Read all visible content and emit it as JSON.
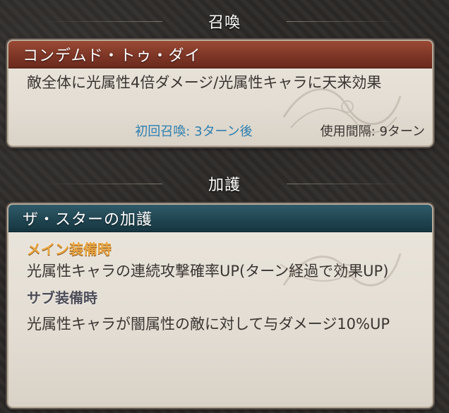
{
  "summon_section": {
    "header": "召喚"
  },
  "summon_panel": {
    "title": "コンデムド・トゥ・ダイ",
    "description": "敵全体に光属性4倍ダメージ/光属性キャラに天来効果",
    "first_summon": "初回召喚: 3ターン後",
    "interval": "使用間隔: 9ターン"
  },
  "aura_section": {
    "header": "加護"
  },
  "aura_panel": {
    "title": "ザ・スターの加護",
    "main_label": "メイン装備時",
    "main_description": "光属性キャラの連続攻撃確率UP(ターン経過で効果UP)",
    "sub_label": "サブ装備時",
    "sub_description": "光属性キャラが闇属性の敵に対して与ダメージ10%UP"
  },
  "colors": {
    "summon_title_bg": "#7e3626",
    "aura_title_bg": "#204652",
    "first_summon_text": "#2d7fb0",
    "main_label": "#e9a544"
  }
}
